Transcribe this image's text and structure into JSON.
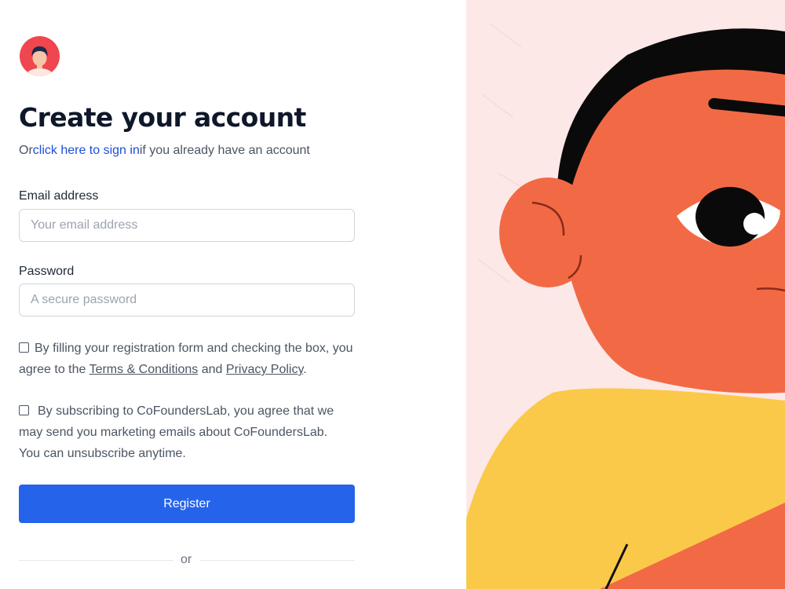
{
  "header": {
    "logo_icon": "avatar-logo-icon",
    "title": "Create your account",
    "subtitle_prefix": "Or",
    "signin_link": "click here to sign in",
    "subtitle_suffix": "if you already have an account"
  },
  "form": {
    "email_label": "Email address",
    "email_placeholder": "Your email address",
    "email_value": "",
    "password_label": "Password",
    "password_placeholder": "A secure password",
    "password_value": "",
    "terms": {
      "checked": false,
      "text_before": "By filling your registration form and checking the box, you agree to the",
      "terms_link": "Terms & Conditions",
      "and_text": "and",
      "privacy_link": "Privacy Policy",
      "period": "."
    },
    "marketing": {
      "checked": false,
      "text": "By subscribing to CoFoundersLab, you agree that we may send you marketing emails about CoFoundersLab. You can unsubscribe anytime."
    },
    "register_label": "Register",
    "or_divider": "or"
  },
  "colors": {
    "accent": "#2563eb",
    "link": "#1d4ed8",
    "illustration_bg": "#fde8e8",
    "skin": "#f26a45",
    "hair": "#0a0a0a",
    "shirt": "#fbc94a"
  },
  "illustration": {
    "icon": "person-illustration"
  }
}
